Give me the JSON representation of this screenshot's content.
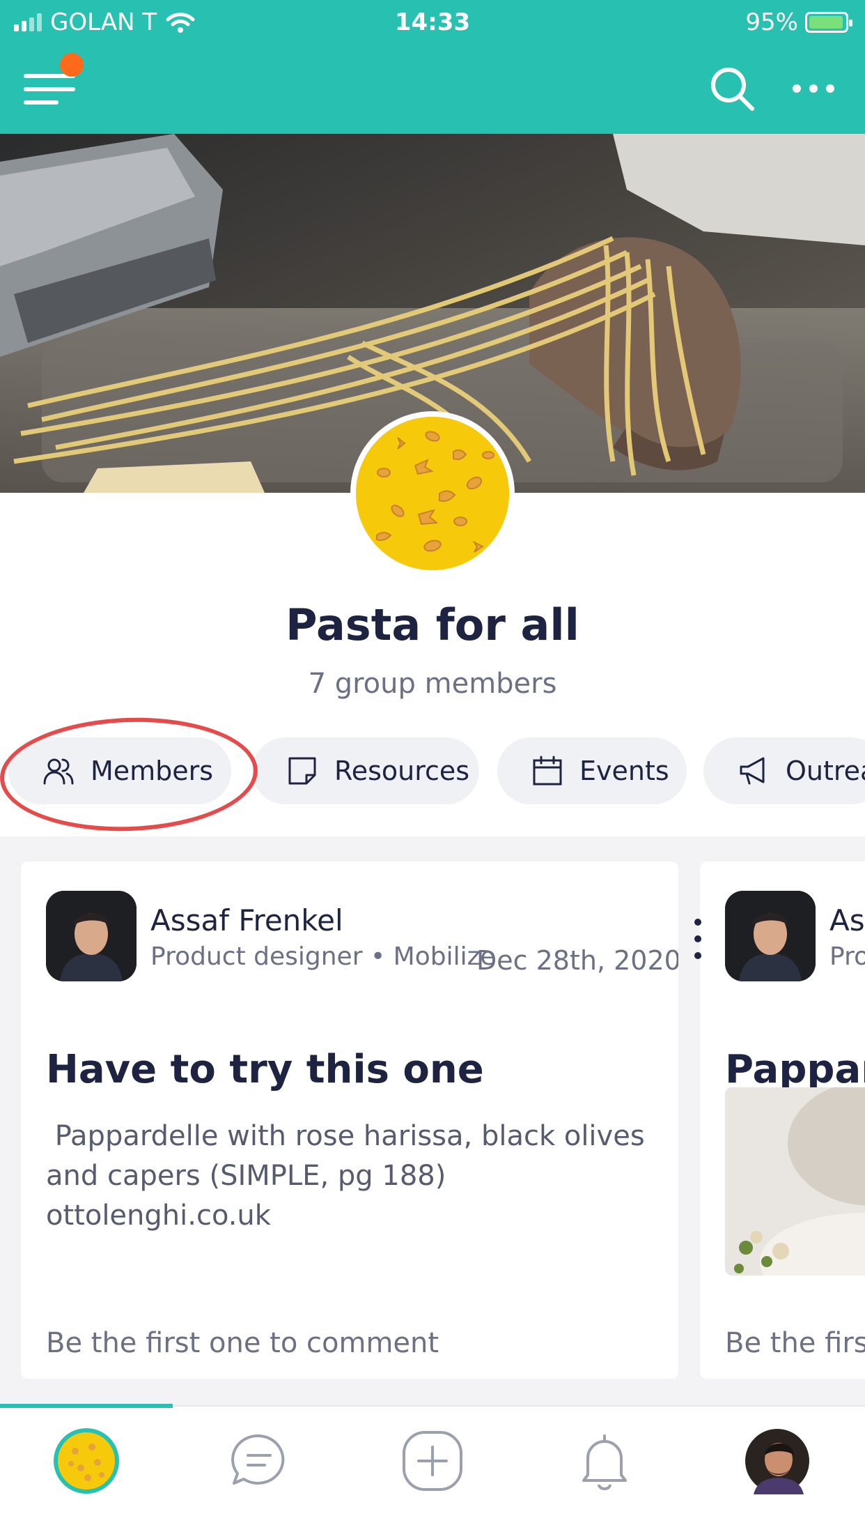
{
  "status_bar": {
    "carrier": "GOLAN T",
    "time": "14:33",
    "battery": "95%",
    "battery_level": 0.95
  },
  "group": {
    "name": "Pasta for all",
    "member_count": "7 group members"
  },
  "tabs": [
    {
      "label": "Members",
      "icon": "members-icon"
    },
    {
      "label": "Resources",
      "icon": "resources-icon"
    },
    {
      "label": "Events",
      "icon": "calendar-icon"
    },
    {
      "label": "Outrea",
      "icon": "megaphone-icon"
    }
  ],
  "posts": [
    {
      "author": "Assaf Frenkel",
      "role": "Product designer • Mobilize",
      "date": "Dec 28th, 2020",
      "title": "Have to try this one",
      "body_lines": [
        " Pappardelle with rose harissa, black olives",
        "and capers (SIMPLE, pg 188)",
        "ottolenghi.co.uk"
      ],
      "comment_prompt": "Be the first one to comment"
    },
    {
      "author": "As",
      "role": "Pro",
      "title": "Pappard",
      "comment_prompt": "Be the firs"
    }
  ],
  "bottom_nav": [
    "group-home",
    "chat",
    "create",
    "notifications",
    "profile"
  ],
  "colors": {
    "accent": "#28c1b1",
    "notification_dot": "#ff6a1a",
    "highlight_ring": "#e54b4b",
    "avatar_yellow": "#f7c90b"
  }
}
